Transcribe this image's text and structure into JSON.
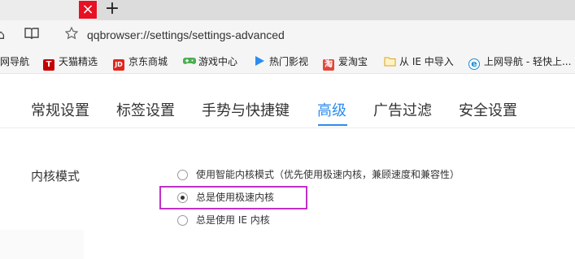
{
  "tabstrip": {
    "close_glyph": "×",
    "new_tab_glyph": "+"
  },
  "address": {
    "url": "qqbrowser://settings/settings-advanced",
    "icons": [
      "home-icon",
      "reading-mode-icon",
      "star-icon"
    ]
  },
  "bookmarks": [
    {
      "label": "网导航",
      "icon": "none"
    },
    {
      "label": "天猫精选",
      "icon": "tmall-icon",
      "glyph": "T",
      "color": "#c40000"
    },
    {
      "label": "京东商城",
      "icon": "jd-icon",
      "glyph": "JD",
      "color": "#e1251b"
    },
    {
      "label": "游戏中心",
      "icon": "gamepad-icon",
      "color": "#4caf50"
    },
    {
      "label": "热门影视",
      "icon": "play-icon",
      "color": "#2d8cf0"
    },
    {
      "label": "爱淘宝",
      "icon": "taobao-icon",
      "glyph": "淘",
      "color": "#e0483d"
    },
    {
      "label": "从 IE 中导入",
      "icon": "folder-icon",
      "color": "#f0c040"
    },
    {
      "label": "上网导航 - 轻快上...",
      "icon": "ie-icon",
      "glyph": "e",
      "color": "#1a8ad4"
    }
  ],
  "settings_tabs": [
    {
      "label": "常规设置",
      "active": false
    },
    {
      "label": "标签设置",
      "active": false
    },
    {
      "label": "手势与快捷键",
      "active": false
    },
    {
      "label": "高级",
      "active": true
    },
    {
      "label": "广告过滤",
      "active": false
    },
    {
      "label": "安全设置",
      "active": false
    }
  ],
  "kernel": {
    "section_label": "内核模式",
    "options": [
      {
        "label": "使用智能内核模式（优先使用极速内核，兼顾速度和兼容性）",
        "selected": false
      },
      {
        "label": "总是使用极速内核",
        "selected": true
      },
      {
        "label": "总是使用 IE 内核",
        "selected": false
      }
    ]
  },
  "colors": {
    "accent": "#2d8cf0",
    "highlight_box": "#c030c8",
    "close_button": "#e81123"
  }
}
